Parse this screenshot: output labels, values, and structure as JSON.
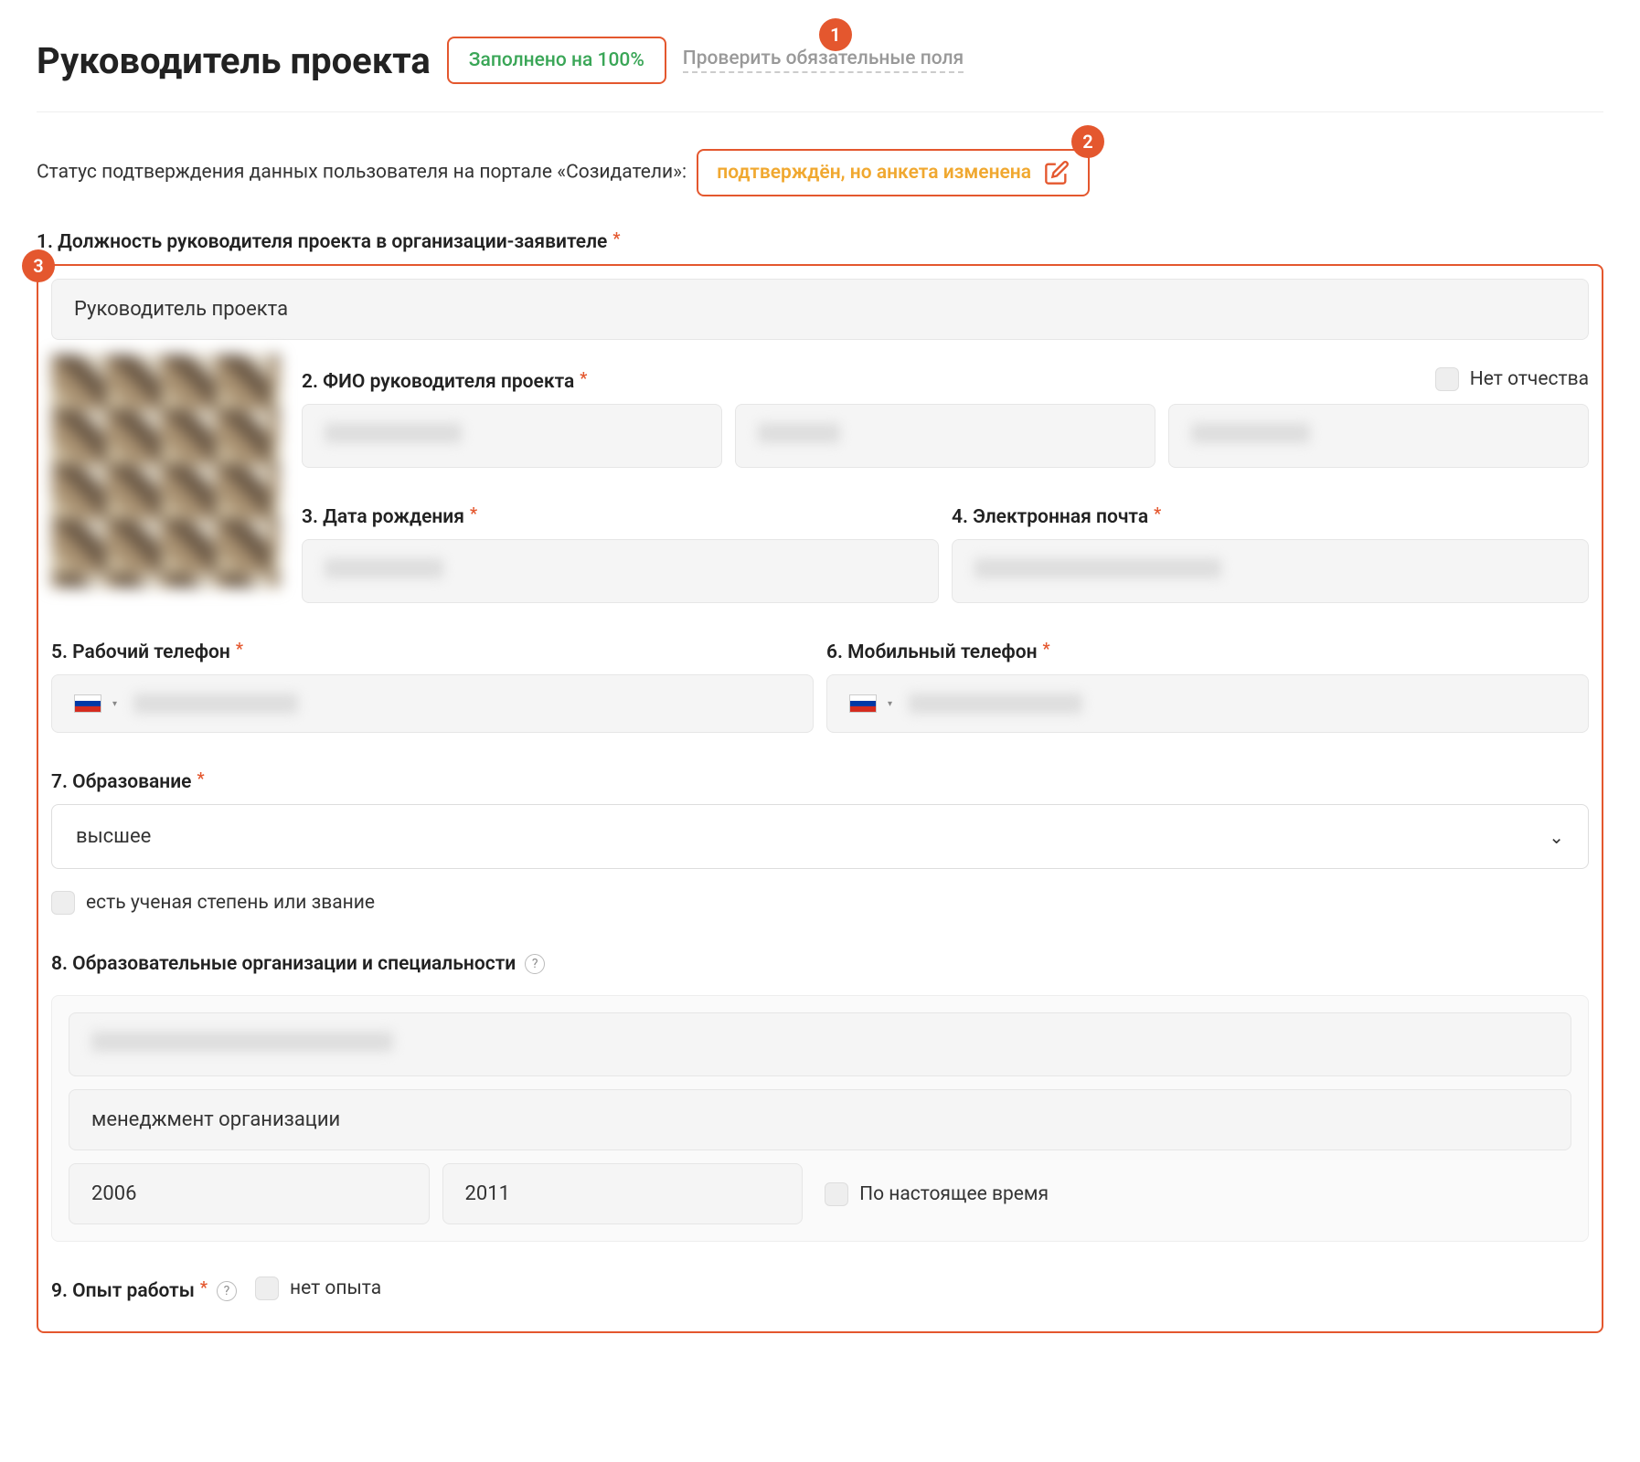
{
  "header": {
    "title": "Руководитель проекта",
    "completion": "Заполнено на 100%",
    "check_link": "Проверить обязательные поля"
  },
  "callouts": {
    "one": "1",
    "two": "2",
    "three": "3"
  },
  "status": {
    "prefix": "Статус подтверждения данных пользователя на портале «Созидатели»:",
    "value": "подтверждён, но анкета изменена"
  },
  "fields": {
    "f1_label": "1. Должность руководителя проекта в организации-заявителе",
    "f1_value": "Руководитель проекта",
    "f2_label": "2. ФИО руководителя проекта",
    "no_patronymic": "Нет отчества",
    "f3_label": "3. Дата рождения",
    "f4_label": "4. Электронная почта",
    "f5_label": "5. Рабочий телефон",
    "f6_label": "6. Мобильный телефон",
    "f7_label": "7. Образование",
    "f7_value": "высшее",
    "degree_check": "есть ученая степень или звание",
    "f8_label": "8. Образовательные организации и специальности",
    "edu_speciality": "менеджмент организации",
    "edu_year_start": "2006",
    "edu_year_end": "2011",
    "edu_present": "По настоящее время",
    "f9_label": "9. Опыт работы",
    "no_exp": "нет опыта"
  }
}
